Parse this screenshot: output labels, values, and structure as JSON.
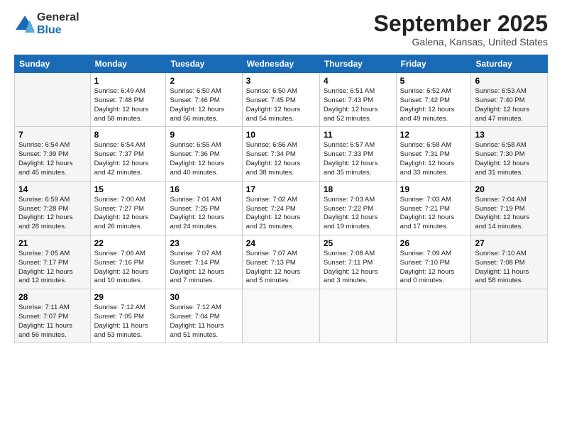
{
  "logo": {
    "general": "General",
    "blue": "Blue"
  },
  "title": "September 2025",
  "location": "Galena, Kansas, United States",
  "headers": [
    "Sunday",
    "Monday",
    "Tuesday",
    "Wednesday",
    "Thursday",
    "Friday",
    "Saturday"
  ],
  "weeks": [
    [
      {
        "num": "",
        "info": ""
      },
      {
        "num": "1",
        "info": "Sunrise: 6:49 AM\nSunset: 7:48 PM\nDaylight: 12 hours\nand 58 minutes."
      },
      {
        "num": "2",
        "info": "Sunrise: 6:50 AM\nSunset: 7:46 PM\nDaylight: 12 hours\nand 56 minutes."
      },
      {
        "num": "3",
        "info": "Sunrise: 6:50 AM\nSunset: 7:45 PM\nDaylight: 12 hours\nand 54 minutes."
      },
      {
        "num": "4",
        "info": "Sunrise: 6:51 AM\nSunset: 7:43 PM\nDaylight: 12 hours\nand 52 minutes."
      },
      {
        "num": "5",
        "info": "Sunrise: 6:52 AM\nSunset: 7:42 PM\nDaylight: 12 hours\nand 49 minutes."
      },
      {
        "num": "6",
        "info": "Sunrise: 6:53 AM\nSunset: 7:40 PM\nDaylight: 12 hours\nand 47 minutes."
      }
    ],
    [
      {
        "num": "7",
        "info": "Sunrise: 6:54 AM\nSunset: 7:39 PM\nDaylight: 12 hours\nand 45 minutes."
      },
      {
        "num": "8",
        "info": "Sunrise: 6:54 AM\nSunset: 7:37 PM\nDaylight: 12 hours\nand 42 minutes."
      },
      {
        "num": "9",
        "info": "Sunrise: 6:55 AM\nSunset: 7:36 PM\nDaylight: 12 hours\nand 40 minutes."
      },
      {
        "num": "10",
        "info": "Sunrise: 6:56 AM\nSunset: 7:34 PM\nDaylight: 12 hours\nand 38 minutes."
      },
      {
        "num": "11",
        "info": "Sunrise: 6:57 AM\nSunset: 7:33 PM\nDaylight: 12 hours\nand 35 minutes."
      },
      {
        "num": "12",
        "info": "Sunrise: 6:58 AM\nSunset: 7:31 PM\nDaylight: 12 hours\nand 33 minutes."
      },
      {
        "num": "13",
        "info": "Sunrise: 6:58 AM\nSunset: 7:30 PM\nDaylight: 12 hours\nand 31 minutes."
      }
    ],
    [
      {
        "num": "14",
        "info": "Sunrise: 6:59 AM\nSunset: 7:28 PM\nDaylight: 12 hours\nand 28 minutes."
      },
      {
        "num": "15",
        "info": "Sunrise: 7:00 AM\nSunset: 7:27 PM\nDaylight: 12 hours\nand 26 minutes."
      },
      {
        "num": "16",
        "info": "Sunrise: 7:01 AM\nSunset: 7:25 PM\nDaylight: 12 hours\nand 24 minutes."
      },
      {
        "num": "17",
        "info": "Sunrise: 7:02 AM\nSunset: 7:24 PM\nDaylight: 12 hours\nand 21 minutes."
      },
      {
        "num": "18",
        "info": "Sunrise: 7:03 AM\nSunset: 7:22 PM\nDaylight: 12 hours\nand 19 minutes."
      },
      {
        "num": "19",
        "info": "Sunrise: 7:03 AM\nSunset: 7:21 PM\nDaylight: 12 hours\nand 17 minutes."
      },
      {
        "num": "20",
        "info": "Sunrise: 7:04 AM\nSunset: 7:19 PM\nDaylight: 12 hours\nand 14 minutes."
      }
    ],
    [
      {
        "num": "21",
        "info": "Sunrise: 7:05 AM\nSunset: 7:17 PM\nDaylight: 12 hours\nand 12 minutes."
      },
      {
        "num": "22",
        "info": "Sunrise: 7:06 AM\nSunset: 7:16 PM\nDaylight: 12 hours\nand 10 minutes."
      },
      {
        "num": "23",
        "info": "Sunrise: 7:07 AM\nSunset: 7:14 PM\nDaylight: 12 hours\nand 7 minutes."
      },
      {
        "num": "24",
        "info": "Sunrise: 7:07 AM\nSunset: 7:13 PM\nDaylight: 12 hours\nand 5 minutes."
      },
      {
        "num": "25",
        "info": "Sunrise: 7:08 AM\nSunset: 7:11 PM\nDaylight: 12 hours\nand 3 minutes."
      },
      {
        "num": "26",
        "info": "Sunrise: 7:09 AM\nSunset: 7:10 PM\nDaylight: 12 hours\nand 0 minutes."
      },
      {
        "num": "27",
        "info": "Sunrise: 7:10 AM\nSunset: 7:08 PM\nDaylight: 11 hours\nand 58 minutes."
      }
    ],
    [
      {
        "num": "28",
        "info": "Sunrise: 7:11 AM\nSunset: 7:07 PM\nDaylight: 11 hours\nand 56 minutes."
      },
      {
        "num": "29",
        "info": "Sunrise: 7:12 AM\nSunset: 7:05 PM\nDaylight: 11 hours\nand 53 minutes."
      },
      {
        "num": "30",
        "info": "Sunrise: 7:12 AM\nSunset: 7:04 PM\nDaylight: 11 hours\nand 51 minutes."
      },
      {
        "num": "",
        "info": ""
      },
      {
        "num": "",
        "info": ""
      },
      {
        "num": "",
        "info": ""
      },
      {
        "num": "",
        "info": ""
      }
    ]
  ]
}
